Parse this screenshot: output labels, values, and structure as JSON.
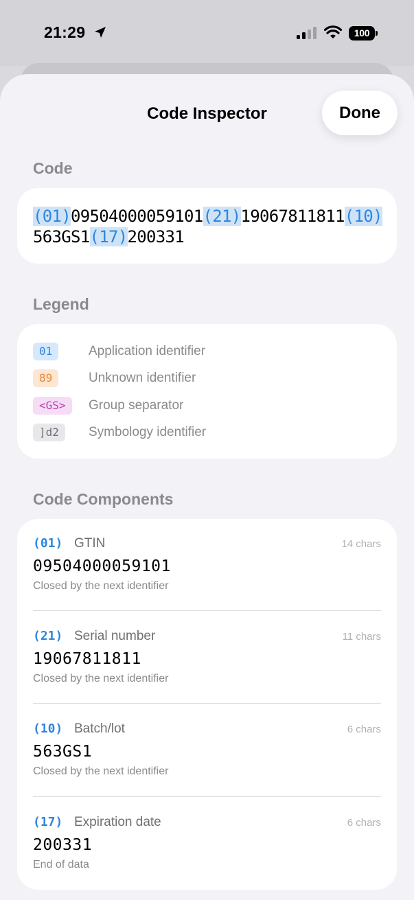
{
  "status_bar": {
    "time": "21:29",
    "battery": "100",
    "icons": [
      "location-arrow-icon",
      "cellular-signal-icon",
      "wifi-icon",
      "battery-icon"
    ]
  },
  "sheet": {
    "title": "Code Inspector",
    "done_label": "Done"
  },
  "code_section": {
    "header": "Code",
    "segments": [
      {
        "text": "(01)",
        "highlight": true
      },
      {
        "text": "09504000059101",
        "highlight": false
      },
      {
        "text": "(21)",
        "highlight": true
      },
      {
        "text": "19067811811",
        "highlight": false
      },
      {
        "text": "(10)",
        "highlight": true
      },
      {
        "text": "563GS1",
        "highlight": false
      },
      {
        "text": "(17)",
        "highlight": true
      },
      {
        "text": "200331",
        "highlight": false
      }
    ]
  },
  "legend": {
    "header": "Legend",
    "items": [
      {
        "badge": "01",
        "label": "Application identifier",
        "bg": "#d6e8fa",
        "fg": "#2e86de"
      },
      {
        "badge": "89",
        "label": "Unknown identifier",
        "bg": "#fde6d2",
        "fg": "#e8893a"
      },
      {
        "badge": "<GS>",
        "label": "Group separator",
        "bg": "#f6dcf5",
        "fg": "#b83fb4"
      },
      {
        "badge": "]d2",
        "label": "Symbology identifier",
        "bg": "#e8e8ea",
        "fg": "#6e6e73"
      }
    ]
  },
  "components": {
    "header": "Code Components",
    "items": [
      {
        "ai": "(01)",
        "name": "GTIN",
        "length": "14 chars",
        "value": "09504000059101",
        "note": "Closed by the next identifier"
      },
      {
        "ai": "(21)",
        "name": "Serial number",
        "length": "11 chars",
        "value": "19067811811",
        "note": "Closed by the next identifier"
      },
      {
        "ai": "(10)",
        "name": "Batch/lot",
        "length": "6 chars",
        "value": "563GS1",
        "note": "Closed by the next identifier"
      },
      {
        "ai": "(17)",
        "name": "Expiration date",
        "length": "6 chars",
        "value": "200331",
        "note": "End of data"
      }
    ]
  },
  "colors": {
    "accent": "#2e86de",
    "sheet_bg": "#f2f2f7",
    "card_bg": "#ffffff",
    "secondary_text": "#8a8a8e"
  }
}
